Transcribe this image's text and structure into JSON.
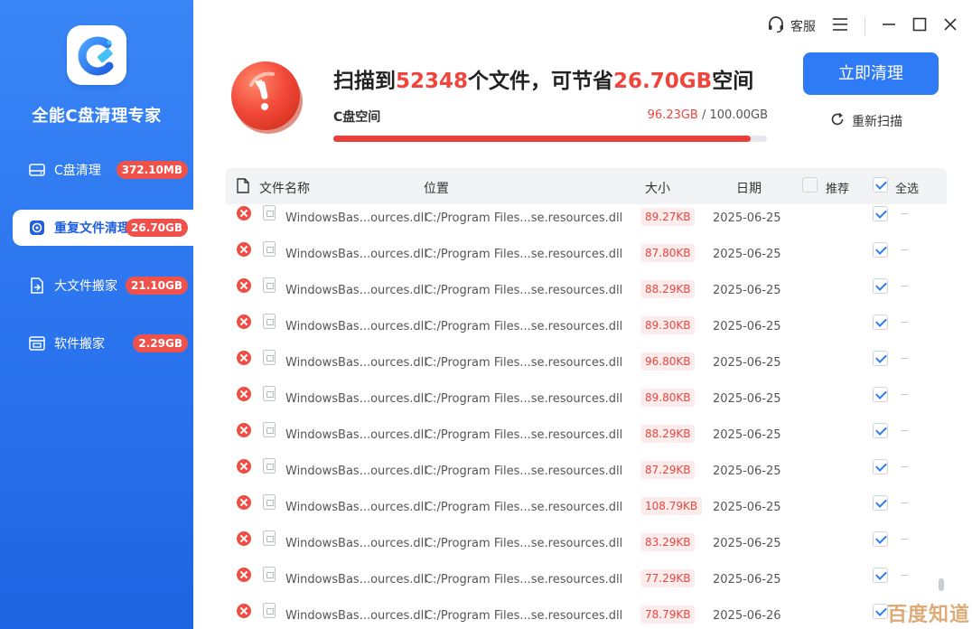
{
  "app": {
    "title": "全能C盘清理专家"
  },
  "sidebar": {
    "items": [
      {
        "label": "C盘清理",
        "badge": "372.10MB",
        "icon": "drive-icon",
        "active": false
      },
      {
        "label": "重复文件清理",
        "badge": "26.70GB",
        "icon": "duplicate-icon",
        "active": true
      },
      {
        "label": "大文件搬家",
        "badge": "21.10GB",
        "icon": "move-file-icon",
        "active": false
      },
      {
        "label": "软件搬家",
        "badge": "2.29GB",
        "icon": "software-icon",
        "active": false
      }
    ]
  },
  "topbar": {
    "service_label": "客服"
  },
  "summary": {
    "prefix": "扫描到",
    "file_count": "52348",
    "middle": "个文件，可节省",
    "saving": "26.70GB",
    "suffix": "空间"
  },
  "disk": {
    "label": "C盘空间",
    "used": "96.23GB",
    "separator": " / ",
    "total": "100.00GB",
    "used_fraction": 0.9623
  },
  "actions": {
    "clean_label": "立即清理",
    "rescan_label": "重新扫描"
  },
  "table": {
    "headers": {
      "name": "文件名称",
      "location": "位置",
      "size": "大小",
      "date": "日期",
      "recommend": "推荐",
      "select_all": "全选"
    },
    "rows": [
      {
        "name": "WindowsBas...ources.dll",
        "location": "C:/Program Files...se.resources.dll",
        "size": "89.27KB",
        "date": "2025-06-25"
      },
      {
        "name": "WindowsBas...ources.dll",
        "location": "C:/Program Files...se.resources.dll",
        "size": "87.80KB",
        "date": "2025-06-25"
      },
      {
        "name": "WindowsBas...ources.dll",
        "location": "C:/Program Files...se.resources.dll",
        "size": "88.29KB",
        "date": "2025-06-25"
      },
      {
        "name": "WindowsBas...ources.dll",
        "location": "C:/Program Files...se.resources.dll",
        "size": "89.30KB",
        "date": "2025-06-25"
      },
      {
        "name": "WindowsBas...ources.dll",
        "location": "C:/Program Files...se.resources.dll",
        "size": "96.80KB",
        "date": "2025-06-25"
      },
      {
        "name": "WindowsBas...ources.dll",
        "location": "C:/Program Files...se.resources.dll",
        "size": "89.80KB",
        "date": "2025-06-25"
      },
      {
        "name": "WindowsBas...ources.dll",
        "location": "C:/Program Files...se.resources.dll",
        "size": "88.29KB",
        "date": "2025-06-25"
      },
      {
        "name": "WindowsBas...ources.dll",
        "location": "C:/Program Files...se.resources.dll",
        "size": "87.29KB",
        "date": "2025-06-25"
      },
      {
        "name": "WindowsBas...ources.dll",
        "location": "C:/Program Files...se.resources.dll",
        "size": "108.79KB",
        "date": "2025-06-25"
      },
      {
        "name": "WindowsBas...ources.dll",
        "location": "C:/Program Files...se.resources.dll",
        "size": "83.29KB",
        "date": "2025-06-25"
      },
      {
        "name": "WindowsBas...ources.dll",
        "location": "C:/Program Files...se.resources.dll",
        "size": "77.29KB",
        "date": "2025-06-25"
      },
      {
        "name": "WindowsBas...ources.dll",
        "location": "C:/Program Files...se.resources.dll",
        "size": "78.79KB",
        "date": "2025-06-26"
      }
    ]
  },
  "watermark": "百度知道",
  "colors": {
    "accent": "#2f7bf5",
    "danger": "#f0453d",
    "sidebar": "#2a73ee"
  }
}
